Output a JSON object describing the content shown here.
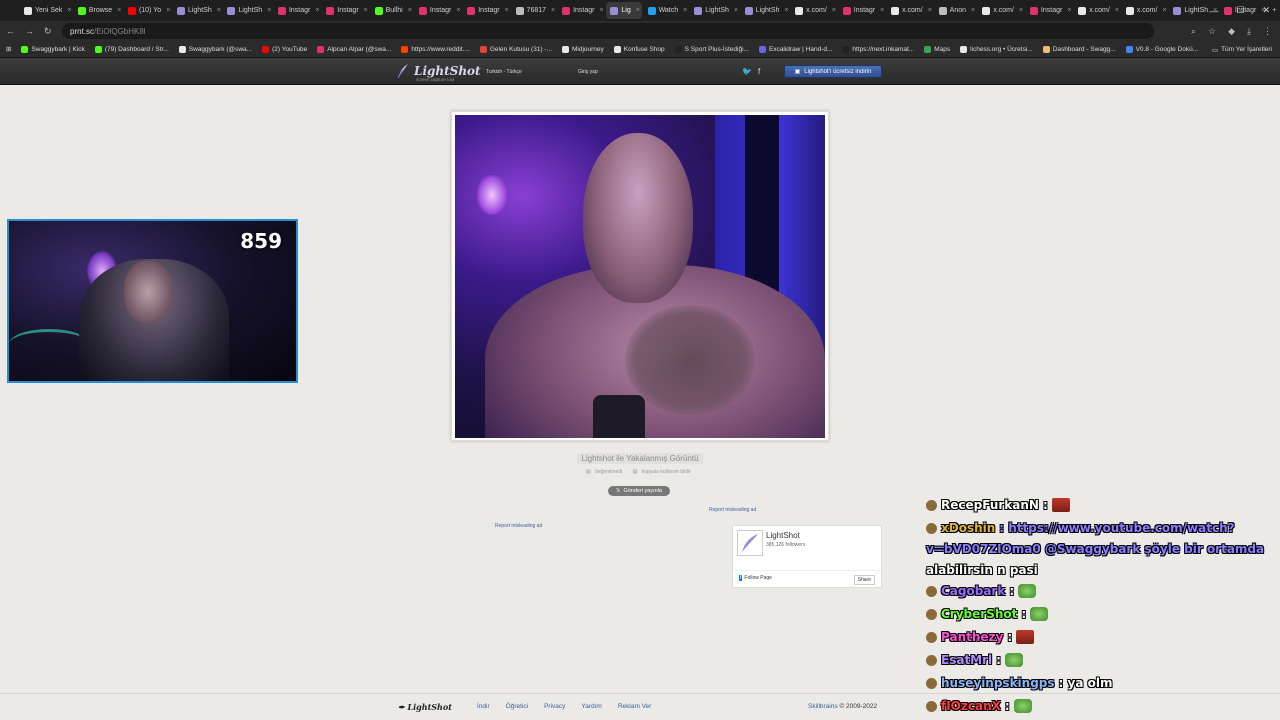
{
  "tabs": [
    {
      "label": "Yeni Sek",
      "color": "#e8e8e8"
    },
    {
      "label": "Browse",
      "color": "#53fc18"
    },
    {
      "label": "(10) Yo",
      "color": "#ff0000"
    },
    {
      "label": "LightSh",
      "color": "#9a8fd6"
    },
    {
      "label": "LightSh",
      "color": "#9a8fd6"
    },
    {
      "label": "Instagr",
      "color": "#e1306c"
    },
    {
      "label": "Instagr",
      "color": "#e1306c"
    },
    {
      "label": "Bullhi",
      "color": "#53fc18"
    },
    {
      "label": "Instagr",
      "color": "#e1306c"
    },
    {
      "label": "Instagr",
      "color": "#e1306c"
    },
    {
      "label": "76817",
      "color": "#bbbbbb"
    },
    {
      "label": "Instagr",
      "color": "#e1306c"
    },
    {
      "label": "Lig",
      "color": "#9a8fd6",
      "active": true
    },
    {
      "label": "Watch",
      "color": "#1da1f2"
    },
    {
      "label": "LightSh",
      "color": "#9a8fd6"
    },
    {
      "label": "LightSh",
      "color": "#9a8fd6"
    },
    {
      "label": "x.com/",
      "color": "#e8e8e8"
    },
    {
      "label": "Instagr",
      "color": "#e1306c"
    },
    {
      "label": "x.com/",
      "color": "#e8e8e8"
    },
    {
      "label": "Anon",
      "color": "#bbbbbb"
    },
    {
      "label": "x.com/",
      "color": "#e8e8e8"
    },
    {
      "label": "Instagr",
      "color": "#e1306c"
    },
    {
      "label": "x.com/",
      "color": "#e8e8e8"
    },
    {
      "label": "x.com/",
      "color": "#e8e8e8"
    },
    {
      "label": "LightSh",
      "color": "#9a8fd6"
    },
    {
      "label": "Instagr",
      "color": "#e1306c"
    }
  ],
  "address": {
    "host": "prnt.sc",
    "path": "/EiOlQGbHK8l"
  },
  "bookmarks": [
    {
      "label": "Swaggybark | Kick",
      "color": "#53fc18"
    },
    {
      "label": "(79) Dashboard / Str...",
      "color": "#53fc18"
    },
    {
      "label": "Swaggybark (@swa...",
      "color": "#e8e8e8"
    },
    {
      "label": "(2) YouTube",
      "color": "#ff0000"
    },
    {
      "label": "Alpcan Alpar (@swa...",
      "color": "#e1306c"
    },
    {
      "label": "https://www.reddit....",
      "color": "#ff4500"
    },
    {
      "label": "Gelen Kutusu (31) -...",
      "color": "#ea4335"
    },
    {
      "label": "Midjourney",
      "color": "#e8e8e8"
    },
    {
      "label": "Konfuse Shop",
      "color": "#e8e8e8"
    },
    {
      "label": "S Sport Plus-İstediği...",
      "color": "#222222"
    },
    {
      "label": "Excalidraw | Hand-d...",
      "color": "#6965db"
    },
    {
      "label": "https://next.inkamat...",
      "color": "#222222"
    },
    {
      "label": "Maps",
      "color": "#34a853"
    },
    {
      "label": "lichess.org • Ücretsi...",
      "color": "#e8e8e8"
    },
    {
      "label": "Dashboard - Swagg...",
      "color": "#e8c070"
    },
    {
      "label": "V0.8 - Google Dokü...",
      "color": "#4285f4"
    }
  ],
  "bookmarks_right": "Tüm Yer İşaretleri",
  "lightshot": {
    "brand": "LightShot",
    "tagline": "screen capture tool",
    "language": "Turkish - Türkçe",
    "login": "Giriş yap",
    "download": "Lightshot'ı ücretsiz indirin",
    "caption": "Lightshot ile Yakalanmış Görüntü",
    "like": "beğenilmedi",
    "copy_link": "kopyala kullanım bildir",
    "tweet": "Gönderi yayınla",
    "report1": "Report misleading ad",
    "report2": "Report misleading ad",
    "fb_name": "LightShot",
    "fb_followers": "385,126 followers",
    "fb_follow": "Follow Page",
    "fb_share": "Share"
  },
  "footer": {
    "brand": "LightShot",
    "links": [
      "İndir",
      "Öğretici",
      "Privacy",
      "Yardım",
      "Reklam Ver"
    ],
    "company": "Skillbrains",
    "copyright": "© 2009-2022"
  },
  "webcam": {
    "count": "859"
  },
  "chat": [
    {
      "user": "RecepFurkanN",
      "color": "#ffffff",
      "text": ":",
      "emote": "red"
    },
    {
      "user": "xDoshin",
      "color": "#e0b43a",
      "text": ": https://www.youtube.com/watch?",
      "link": true
    },
    {
      "user": "",
      "color": "#ffffff",
      "text": "v=bVD07ZIOma0 @Swaggybark şöyle bir ortamda",
      "link": true
    },
    {
      "user": "",
      "color": "#ffffff",
      "text": "alabilirsin n pasi",
      "link": false
    },
    {
      "user": "Cagobark",
      "color": "#9a6bff",
      "text": ":",
      "emote": "green"
    },
    {
      "user": "CryberShot",
      "color": "#66ff33",
      "text": ":",
      "emote": "green"
    },
    {
      "user": "Panthezy",
      "color": "#ff4fd8",
      "text": ":",
      "emote": "red"
    },
    {
      "user": "EsatMrl",
      "color": "#b08cff",
      "text": ":",
      "emote": "green"
    },
    {
      "user": "huseyinpskingps",
      "color": "#8ab4f8",
      "text": ": ya olm"
    },
    {
      "user": "fIOzcanX",
      "color": "#ff3b3b",
      "text": ":",
      "emote": "green"
    }
  ]
}
